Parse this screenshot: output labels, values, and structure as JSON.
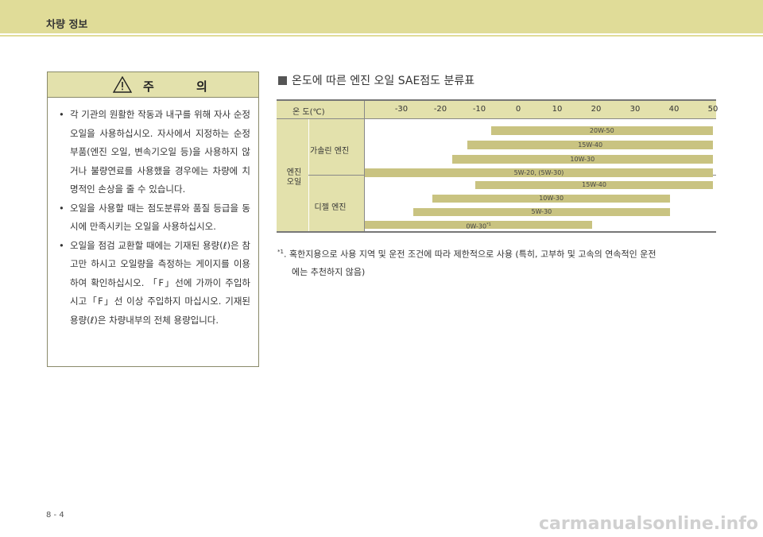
{
  "header": {
    "title": "차량 정보"
  },
  "caution": {
    "title": "주 의",
    "items": [
      "각 기관의 원활한 작동과 내구를 위해 자사 순정오일을 사용하십시오. 자사에서 지정하는 순정부품(엔진 오일, 변속기오일 등)을 사용하지 않거나 불량연료를 사용했을 경우에는 차량에 치명적인 손상을 줄 수 있습니다.",
      "오일을 사용할 때는 점도분류와 품질 등급을 동시에 만족시키는 오일을 사용하십시오.",
      "오일을 점검 교환할 때에는 기재된 용량(ℓ)은 참고만 하시고 오일량을 측정하는 게이지를 이용하여 확인하십시오. 「F」선에 가까이 주입하시고「F」선 이상 주입하지 마십시오. 기재된 용량(ℓ)은 차량내부의 전체 용량입니다."
    ]
  },
  "section_title": "온도에 따른 엔진 오일 SAE점도 분류표",
  "chart_data": {
    "type": "bar",
    "title": "온도에 따른 엔진 오일 SAE점도 분류표",
    "xlabel": "온 도(℃)",
    "x_ticks": [
      "-30",
      "-20",
      "-10",
      "0",
      "10",
      "20",
      "30",
      "40",
      "50"
    ],
    "xlim": [
      -30,
      50
    ],
    "category_label": "엔진 오일",
    "groups": [
      {
        "name": "가솔린 엔진",
        "bars": [
          {
            "label": "20W-50",
            "range": [
              -7,
              50
            ]
          },
          {
            "label": "15W-40",
            "range": [
              -13,
              50
            ]
          },
          {
            "label": "10W-30",
            "range": [
              -17,
              50
            ]
          },
          {
            "label": "5W-20, (5W-30)",
            "range": [
              -40,
              50
            ]
          }
        ]
      },
      {
        "name": "디젤 엔진",
        "bars": [
          {
            "label": "15W-40",
            "range": [
              -11,
              50
            ]
          },
          {
            "label": "10W-30",
            "range": [
              -22,
              39
            ]
          },
          {
            "label": "5W-30",
            "range": [
              -27,
              39
            ]
          },
          {
            "label": "0W-30",
            "label_sup": "*1",
            "range": [
              -40,
              19
            ]
          }
        ]
      }
    ]
  },
  "footnote": {
    "marker": "*1",
    "text1": ". 혹한지용으로 사용 지역 및 운전 조건에 따라 제한적으로 사용 (특히, 고부하 및 고속의 연속적인 운전",
    "text2": "에는 추천하지 않음)"
  },
  "page_number": "8 - 4",
  "watermark": "carmanualsonline.info"
}
